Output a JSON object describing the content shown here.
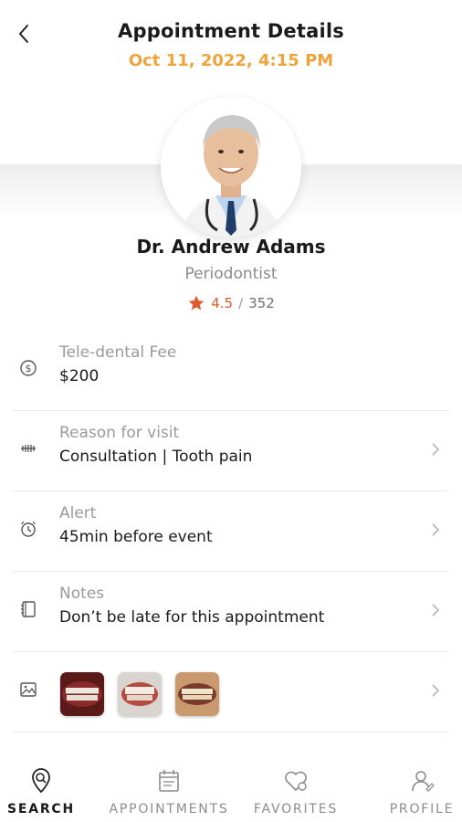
{
  "header": {
    "title": "Appointment Details",
    "datetime": "Oct 11, 2022, 4:15 PM"
  },
  "doctor": {
    "name": "Dr. Andrew Adams",
    "specialty": "Periodontist",
    "rating": "4.5",
    "rating_separator": "/",
    "review_count": "352"
  },
  "details": {
    "fee": {
      "label": "Tele-dental Fee",
      "value": "$200"
    },
    "reason": {
      "label": "Reason for visit",
      "value": "Consultation | Tooth pain"
    },
    "alert": {
      "label": "Alert",
      "value": "45min before event"
    },
    "notes": {
      "label": "Notes",
      "value": "Don’t be late for this appointment"
    }
  },
  "nav": {
    "search": "SEARCH",
    "appointments": "APPOINTMENTS",
    "favorites": "FAVORITES",
    "profile": "PROFILE"
  },
  "colors": {
    "accent_orange": "#f0a33a",
    "star_red": "#e05a2b"
  }
}
